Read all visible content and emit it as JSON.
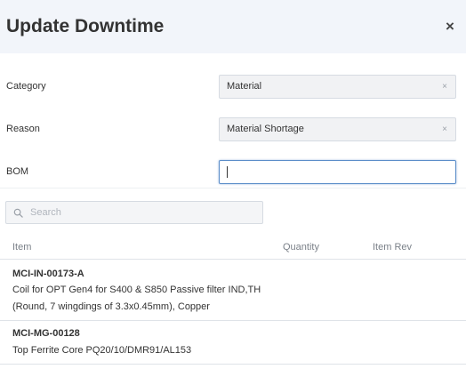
{
  "dialog": {
    "title": "Update Downtime",
    "close_icon": "×"
  },
  "form": {
    "category": {
      "label": "Category",
      "value": "Material",
      "clear": "×"
    },
    "reason": {
      "label": "Reason",
      "value": "Material Shortage",
      "clear": "×"
    },
    "bom": {
      "label": "BOM",
      "value": ""
    }
  },
  "picker": {
    "search_placeholder": "Search",
    "columns": {
      "item": "Item",
      "quantity": "Quantity",
      "item_rev": "Item Rev"
    },
    "rows": [
      {
        "code": "MCI-IN-00173-A",
        "desc_line1": "Coil for OPT Gen4 for S400 & S850 Passive filter IND,TH",
        "desc_line2": "(Round, 7 wingdings of 3.3x0.45mm), Copper"
      },
      {
        "code": "MCI-MG-00128",
        "desc_line1": "Top Ferrite Core PQ20/10/DMR91/AL153"
      }
    ]
  },
  "colors": {
    "header_bg": "#f2f5fa",
    "focus_border": "#5b8dc9",
    "field_bg": "#f1f2f4"
  }
}
